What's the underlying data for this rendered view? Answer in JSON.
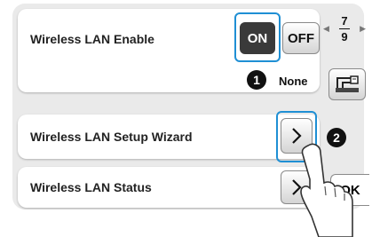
{
  "rows": [
    {
      "label": "Wireless LAN Enable",
      "on_label": "ON",
      "off_label": "OFF",
      "value_label": "None"
    },
    {
      "label": "Wireless LAN Setup Wizard"
    },
    {
      "label": "Wireless LAN Status"
    }
  ],
  "callouts": {
    "one": "1",
    "two": "2"
  },
  "pager": {
    "current": "7",
    "total": "9"
  },
  "ok_label": "OK",
  "icons": {
    "next_row": "chevron-right-icon",
    "page_prev": "triangle-left-icon",
    "page_next": "triangle-right-icon",
    "machine_settings": "sewing-machine-icon",
    "finger": "pointing-finger-icon"
  },
  "colors": {
    "highlight": "#1f8fd4",
    "on_active": "#3a3a3a",
    "panel": "#eaeaea"
  }
}
